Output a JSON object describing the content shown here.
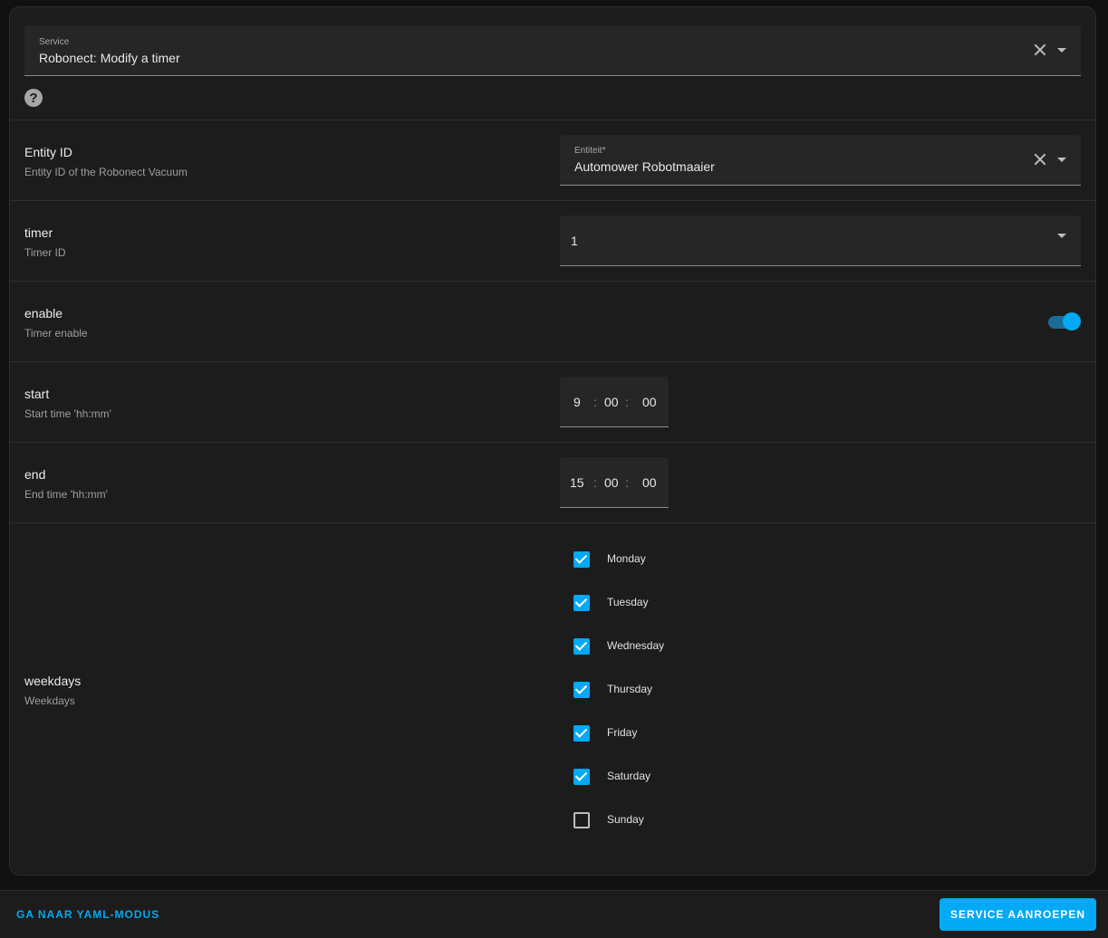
{
  "service": {
    "label": "Service",
    "value": "Robonect: Modify a timer",
    "help_icon": "help-circle-icon"
  },
  "fields": {
    "entity": {
      "title": "Entity ID",
      "description": "Entity ID of the Robonect Vacuum",
      "input_label": "Entiteit*",
      "value": "Automower Robotmaaier"
    },
    "timer": {
      "title": "timer",
      "description": "Timer ID",
      "value": "1"
    },
    "enable": {
      "title": "enable",
      "description": "Timer enable",
      "checked": true
    },
    "start": {
      "title": "start",
      "description": "Start time 'hh:mm'",
      "hours": "9",
      "minutes": "00",
      "seconds": "00"
    },
    "end": {
      "title": "end",
      "description": "End time 'hh:mm'",
      "hours": "15",
      "minutes": "00",
      "seconds": "00"
    },
    "weekdays": {
      "title": "weekdays",
      "description": "Weekdays",
      "options": [
        {
          "label": "Monday",
          "checked": true
        },
        {
          "label": "Tuesday",
          "checked": true
        },
        {
          "label": "Wednesday",
          "checked": true
        },
        {
          "label": "Thursday",
          "checked": true
        },
        {
          "label": "Friday",
          "checked": true
        },
        {
          "label": "Saturday",
          "checked": true
        },
        {
          "label": "Sunday",
          "checked": false
        }
      ]
    }
  },
  "footer": {
    "yaml_label": "GA NAAR YAML-MODUS",
    "call_label": "SERVICE AANROEPEN"
  },
  "colors": {
    "accent": "#03a9f4",
    "background": "#1c1c1c"
  }
}
